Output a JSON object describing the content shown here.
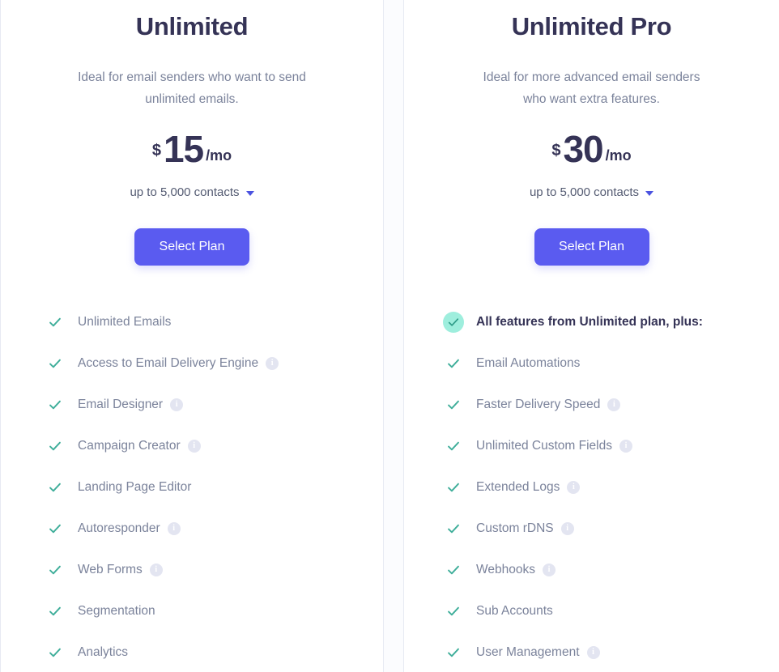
{
  "plans": [
    {
      "name": "Unlimited",
      "description": "Ideal for email senders who want to send unlimited emails.",
      "currency": "$",
      "price": "15",
      "period": "/mo",
      "contacts": "up to 5,000 contacts",
      "cta": "Select Plan",
      "features": [
        {
          "label": "Unlimited Emails",
          "info": false,
          "highlight": false
        },
        {
          "label": "Access to Email Delivery Engine",
          "info": true,
          "highlight": false
        },
        {
          "label": "Email Designer",
          "info": true,
          "highlight": false
        },
        {
          "label": "Campaign Creator",
          "info": true,
          "highlight": false
        },
        {
          "label": "Landing Page Editor",
          "info": false,
          "highlight": false
        },
        {
          "label": "Autoresponder",
          "info": true,
          "highlight": false
        },
        {
          "label": "Web Forms",
          "info": true,
          "highlight": false
        },
        {
          "label": "Segmentation",
          "info": false,
          "highlight": false
        },
        {
          "label": "Analytics",
          "info": false,
          "highlight": false
        }
      ]
    },
    {
      "name": "Unlimited Pro",
      "description": "Ideal for more advanced email senders who want extra features.",
      "currency": "$",
      "price": "30",
      "period": "/mo",
      "contacts": "up to 5,000 contacts",
      "cta": "Select Plan",
      "features": [
        {
          "label": "All features from Unlimited plan, plus:",
          "info": false,
          "highlight": true
        },
        {
          "label": "Email Automations",
          "info": false,
          "highlight": false
        },
        {
          "label": "Faster Delivery Speed",
          "info": true,
          "highlight": false
        },
        {
          "label": "Unlimited Custom Fields",
          "info": true,
          "highlight": false
        },
        {
          "label": "Extended Logs",
          "info": true,
          "highlight": false
        },
        {
          "label": "Custom rDNS",
          "info": true,
          "highlight": false
        },
        {
          "label": "Webhooks",
          "info": true,
          "highlight": false
        },
        {
          "label": "Sub Accounts",
          "info": false,
          "highlight": false
        },
        {
          "label": "User Management",
          "info": true,
          "highlight": false
        }
      ]
    }
  ],
  "icons": {
    "info_glyph": "i",
    "check": "check-icon",
    "caret": "chevron-down-icon"
  },
  "colors": {
    "accent": "#5a5bf0",
    "title": "#353356",
    "muted": "#7b839b",
    "check": "#3fae9a",
    "badge_bg": "#9eeedd",
    "info_bg": "#e3e5f1",
    "border": "#e7eaf3",
    "gutter_bg": "#fbfcfe"
  }
}
